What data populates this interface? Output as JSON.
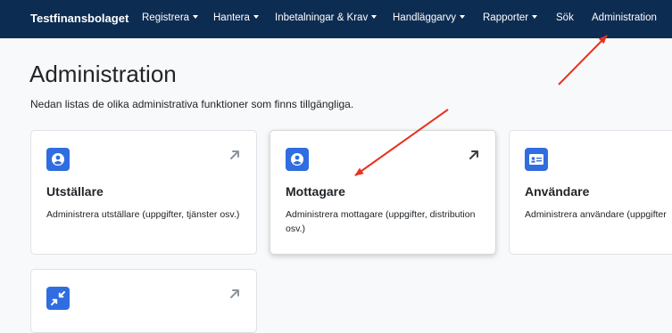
{
  "app": {
    "brand": "Testfinansbolaget"
  },
  "nav": {
    "items": [
      {
        "label": "Registrera",
        "dropdown": true
      },
      {
        "label": "Hantera",
        "dropdown": true
      },
      {
        "label": "Inbetalningar & Krav",
        "dropdown": true
      },
      {
        "label": "Handläggarvy",
        "dropdown": true
      },
      {
        "label": "Rapporter",
        "dropdown": true
      },
      {
        "label": "Sök",
        "dropdown": false
      },
      {
        "label": "Administration",
        "dropdown": false
      }
    ]
  },
  "page": {
    "title": "Administration",
    "description": "Nedan listas de olika administrativa funktioner som finns tillgängliga."
  },
  "cards": [
    {
      "title": "Utställare",
      "description": "Administrera utställare (uppgifter, tjänster osv.)",
      "icon": "user-circle-icon"
    },
    {
      "title": "Mottagare",
      "description": "Administrera mottagare (uppgifter, distribution osv.)",
      "icon": "user-circle-icon"
    },
    {
      "title": "Användare",
      "description": "Administrera användare (uppgifter",
      "icon": "id-card-icon"
    },
    {
      "title": "",
      "description": "",
      "icon": "compress-arrows-icon"
    }
  ],
  "colors": {
    "navbar": "#0d2c52",
    "icon_bg": "#2f6de0",
    "annotation_arrow": "#e8321f"
  }
}
